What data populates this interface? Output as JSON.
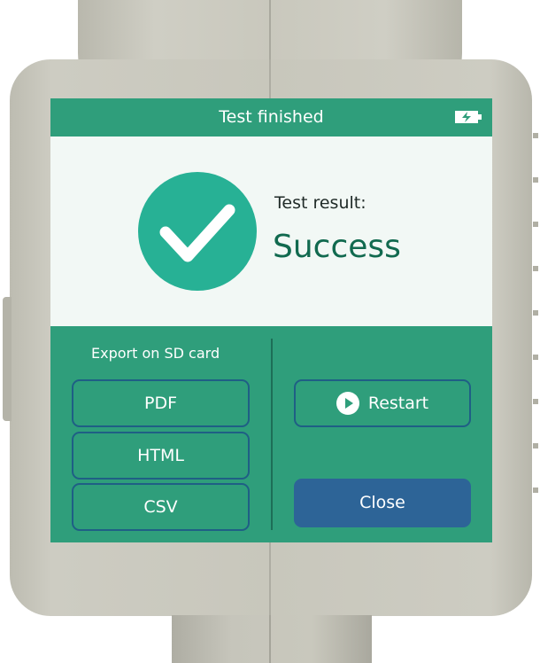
{
  "header": {
    "title": "Test finished",
    "battery_icon": "battery-charging-icon"
  },
  "result": {
    "status_icon": "checkmark-icon",
    "label": "Test result:",
    "value": "Success"
  },
  "export": {
    "title": "Export on SD card",
    "buttons": [
      {
        "label": "PDF"
      },
      {
        "label": "HTML"
      },
      {
        "label": "CSV"
      }
    ]
  },
  "actions": {
    "restart_label": "Restart",
    "restart_icon": "play-icon",
    "close_label": "Close"
  },
  "colors": {
    "screen_green": "#2f9e7b",
    "check_circle": "#27b195",
    "result_text": "#116a4f",
    "close_button": "#2d6497",
    "button_border": "#1f5f85"
  }
}
